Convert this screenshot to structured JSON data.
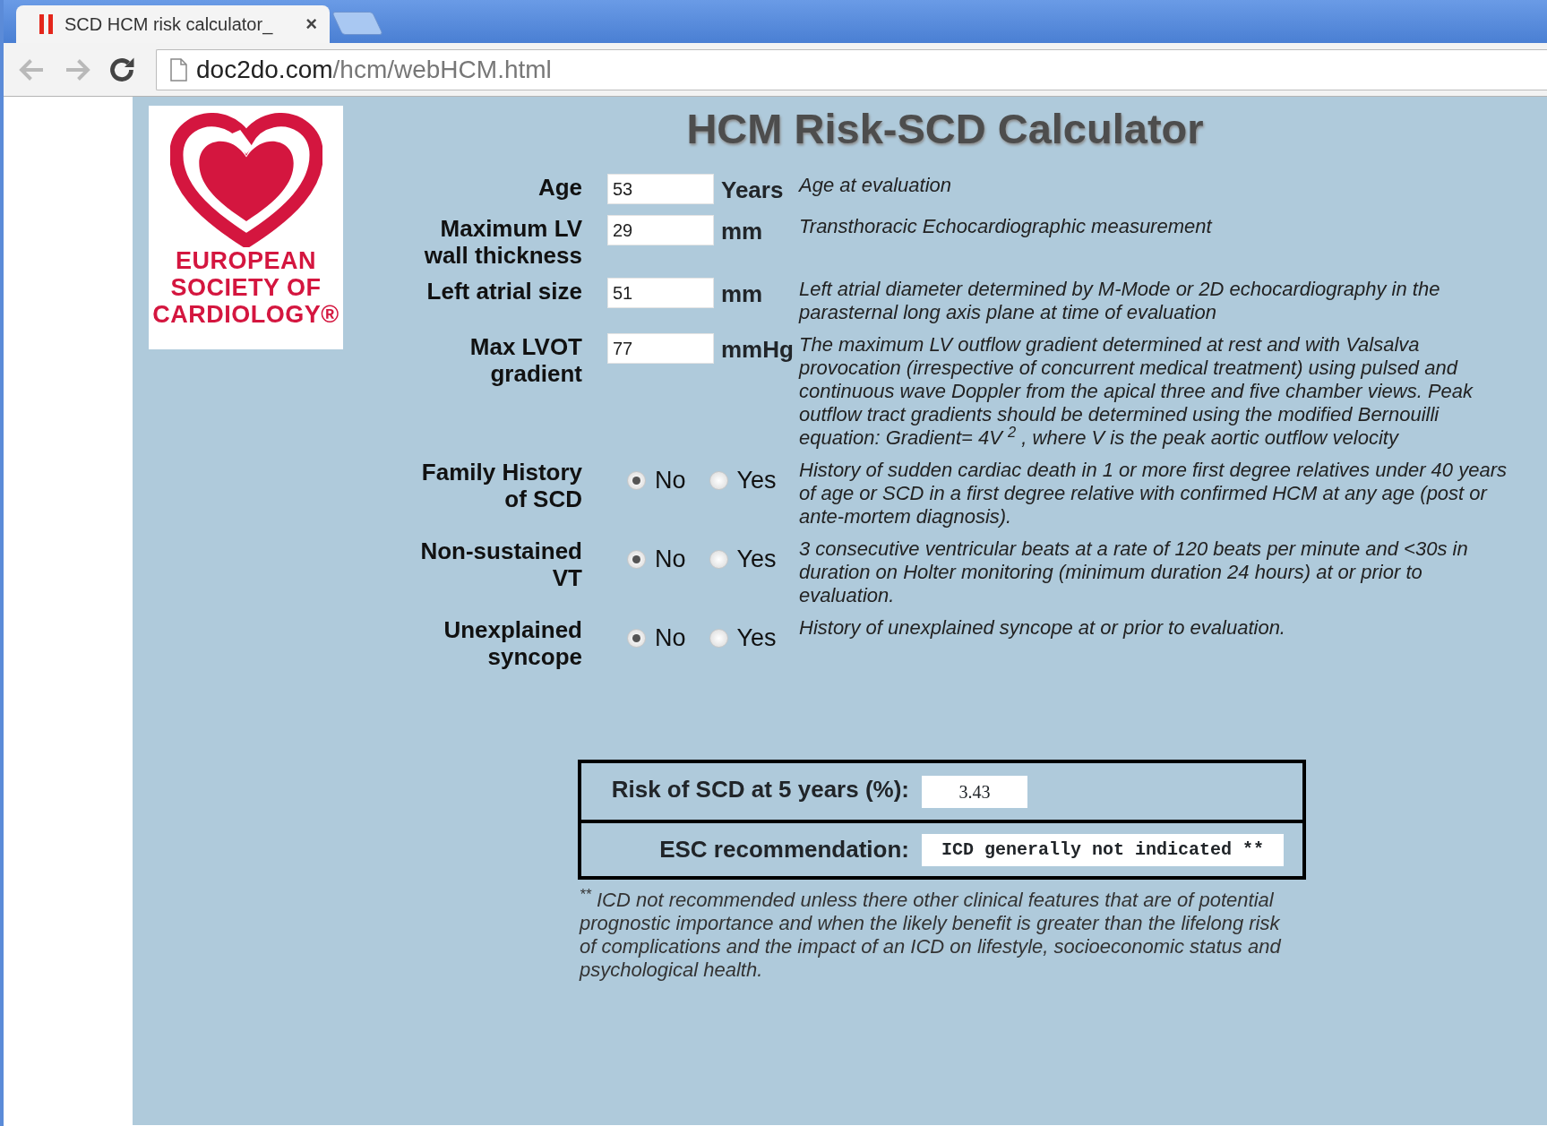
{
  "browser": {
    "tab_title": "SCD HCM risk calculator_",
    "tab_close": "×",
    "url_host": "doc2do.com",
    "url_path": "/hcm/webHCM.html"
  },
  "logo_lines": [
    "EUROPEAN",
    "SOCIETY OF",
    "CARDIOLOGY®"
  ],
  "title": "HCM Risk-SCD Calculator",
  "fields": [
    {
      "kind": "input",
      "label": "Age",
      "value": "53",
      "unit": "Years",
      "description": "Age at evaluation"
    },
    {
      "kind": "input",
      "label": "Maximum LV wall thickness",
      "value": "29",
      "unit": "mm",
      "description": "Transthoracic Echocardiographic measurement"
    },
    {
      "kind": "input",
      "label": "Left atrial size",
      "value": "51",
      "unit": "mm",
      "description": "Left atrial diameter determined by M-Mode or 2D echocardiography in the parasternal long axis plane at time of evaluation"
    },
    {
      "kind": "input",
      "label": "Max LVOT gradient",
      "value": "77",
      "unit": "mmHg",
      "description": "The maximum LV outflow gradient determined at rest and with Valsalva provocation (irrespective of concurrent medical treatment) using pulsed and continuous wave Doppler from the apical three and five chamber views. Peak outflow tract gradients should be determined using the modified Bernouilli equation: Gradient= 4V $^{2}$ , where V is the peak aortic outflow velocity"
    },
    {
      "kind": "radio",
      "label": "Family History of SCD",
      "options": [
        {
          "label": "No",
          "selected": true
        },
        {
          "label": "Yes",
          "selected": false
        }
      ],
      "description": "History of sudden cardiac death in 1 or more first degree relatives under 40 years of age or SCD in a first degree relative with confirmed HCM at any age (post or ante-mortem diagnosis)."
    },
    {
      "kind": "radio",
      "label": "Non-sustained VT",
      "options": [
        {
          "label": "No",
          "selected": true
        },
        {
          "label": "Yes",
          "selected": false
        }
      ],
      "description": "3 consecutive ventricular beats at a rate of 120 beats per minute and <30s in duration on Holter monitoring (minimum duration 24 hours) at or prior to evaluation."
    },
    {
      "kind": "radio",
      "label": "Unexplained syncope",
      "options": [
        {
          "label": "No",
          "selected": true
        },
        {
          "label": "Yes",
          "selected": false
        }
      ],
      "description": "History of unexplained syncope at or prior to evaluation."
    }
  ],
  "result": {
    "risk_label": "Risk of SCD at 5 years (%):",
    "risk_value": "3.43",
    "recommendation_label": "ESC recommendation:",
    "recommendation_value": "ICD generally not indicated **"
  },
  "footnote": "$^{**}$ ICD not recommended unless there other clinical features that are of potential prognostic importance and when the likely benefit is greater than the lifelong risk of complications and the impact of an ICD on lifestyle, socioeconomic status and psychological health."
}
